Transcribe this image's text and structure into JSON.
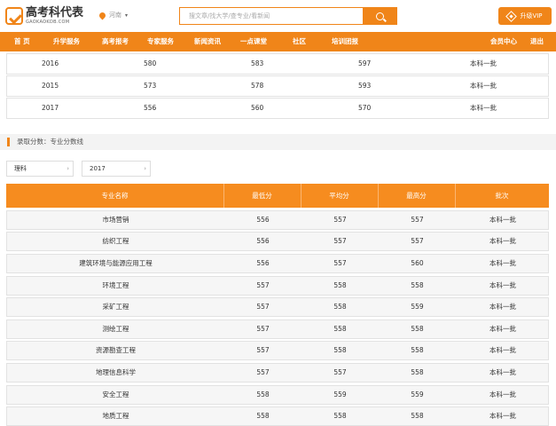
{
  "header": {
    "logo_cn": "高考科代表",
    "logo_en": "GAOKAOKDB.COM",
    "location": "河南",
    "search_placeholder": "搜文章/找大学/查专业/看新闻",
    "vip_label": "升级VIP"
  },
  "nav": {
    "items": [
      "首 页",
      "升学服务",
      "高考报考",
      "专家服务",
      "新闻资讯",
      "一点课堂",
      "社区",
      "培训团报"
    ],
    "member_center": "会员中心",
    "logout": "退出"
  },
  "top_table": {
    "rows": [
      [
        "2016",
        "580",
        "583",
        "597",
        "本科一批"
      ],
      [
        "2015",
        "573",
        "578",
        "593",
        "本科一批"
      ],
      [
        "2017",
        "556",
        "560",
        "570",
        "本科一批"
      ]
    ]
  },
  "section": {
    "title": "录取分数：专业分数线"
  },
  "filters": {
    "subject": "理科",
    "year": "2017"
  },
  "main_table": {
    "headers": [
      "专业名称",
      "最低分",
      "平均分",
      "最高分",
      "批次"
    ],
    "rows": [
      [
        "市场营销",
        "556",
        "557",
        "557",
        "本科一批"
      ],
      [
        "纺织工程",
        "556",
        "557",
        "557",
        "本科一批"
      ],
      [
        "建筑环境与能源应用工程",
        "556",
        "557",
        "560",
        "本科一批"
      ],
      [
        "环境工程",
        "557",
        "558",
        "558",
        "本科一批"
      ],
      [
        "采矿工程",
        "557",
        "558",
        "559",
        "本科一批"
      ],
      [
        "测绘工程",
        "557",
        "558",
        "558",
        "本科一批"
      ],
      [
        "资源勘查工程",
        "557",
        "558",
        "558",
        "本科一批"
      ],
      [
        "地理信息科学",
        "557",
        "557",
        "558",
        "本科一批"
      ],
      [
        "安全工程",
        "558",
        "559",
        "559",
        "本科一批"
      ],
      [
        "地质工程",
        "558",
        "558",
        "558",
        "本科一批"
      ]
    ]
  },
  "colors": {
    "accent": "#f08519",
    "table_header": "#f68c1f",
    "row_bg": "#f6f6f6"
  }
}
